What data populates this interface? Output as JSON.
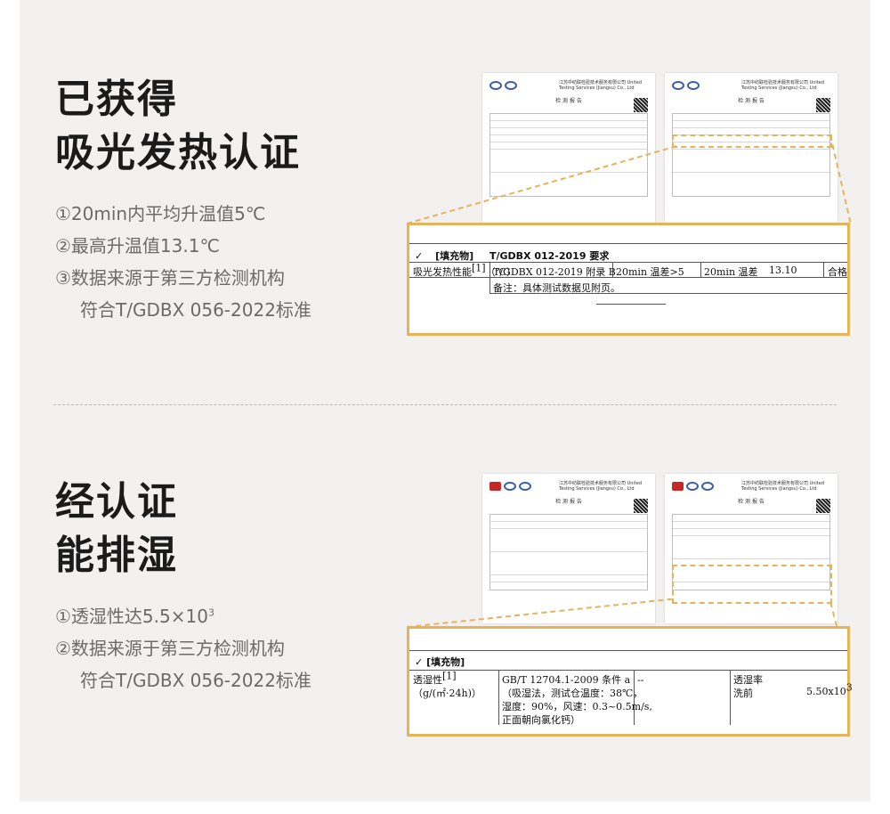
{
  "section1": {
    "heading": [
      "已获得",
      "吸光发热认证"
    ],
    "bullets": [
      "①20min内平均升温值5℃",
      "②最高升温值13.1℃",
      "③数据来源于第三方检测机构",
      "符合T/GDBX 056-2022标准"
    ],
    "zoom": {
      "check": "✓",
      "tag": "[填充物]",
      "std_req": "T/GDBX 012-2019 要求",
      "item": "吸光发热性能",
      "item_sup": "[1]",
      "unit": "（℃）",
      "method": "T/GDBX 012-2019 附录 B",
      "requirement": "20min 温差>5",
      "result_label": "20min 温差",
      "result_value": "13.10",
      "verdict": "合格",
      "note": "备注：具体测试数据见附页。"
    }
  },
  "section2": {
    "heading": [
      "经认证",
      "能排湿"
    ],
    "bullets": [
      "①透湿性达5.5×10",
      "②数据来源于第三方检测机构",
      "符合T/GDBX 056-2022标准"
    ],
    "bullet1_sup": "3",
    "zoom": {
      "check": "✓",
      "tag": "[填充物]",
      "item": "透湿性",
      "item_sup": "[1]",
      "unit": "（g/(㎡·24h)）",
      "method_lines": [
        "GB/T 12704.1-2009 条件 a",
        "（吸湿法，测试仓温度：38℃，",
        "湿度：90%，风速：0.3~0.5m/s,",
        "正面朝向氯化钙）"
      ],
      "requirement": "--",
      "result_label1": "透湿率",
      "result_label2": "洗前",
      "result_value": "5.50x10",
      "result_sup": "3"
    }
  },
  "thumb": {
    "org_name": "江苏中纺联检验技术服务有限公司 United Testing Services (Jiangsu) Co., Ltd",
    "title": "检 测 报 告"
  },
  "colors": {
    "accent": "#e7b35a",
    "panel": "#f2f1f0",
    "heading": "#1b1b1b",
    "body": "#6b6b6b"
  }
}
